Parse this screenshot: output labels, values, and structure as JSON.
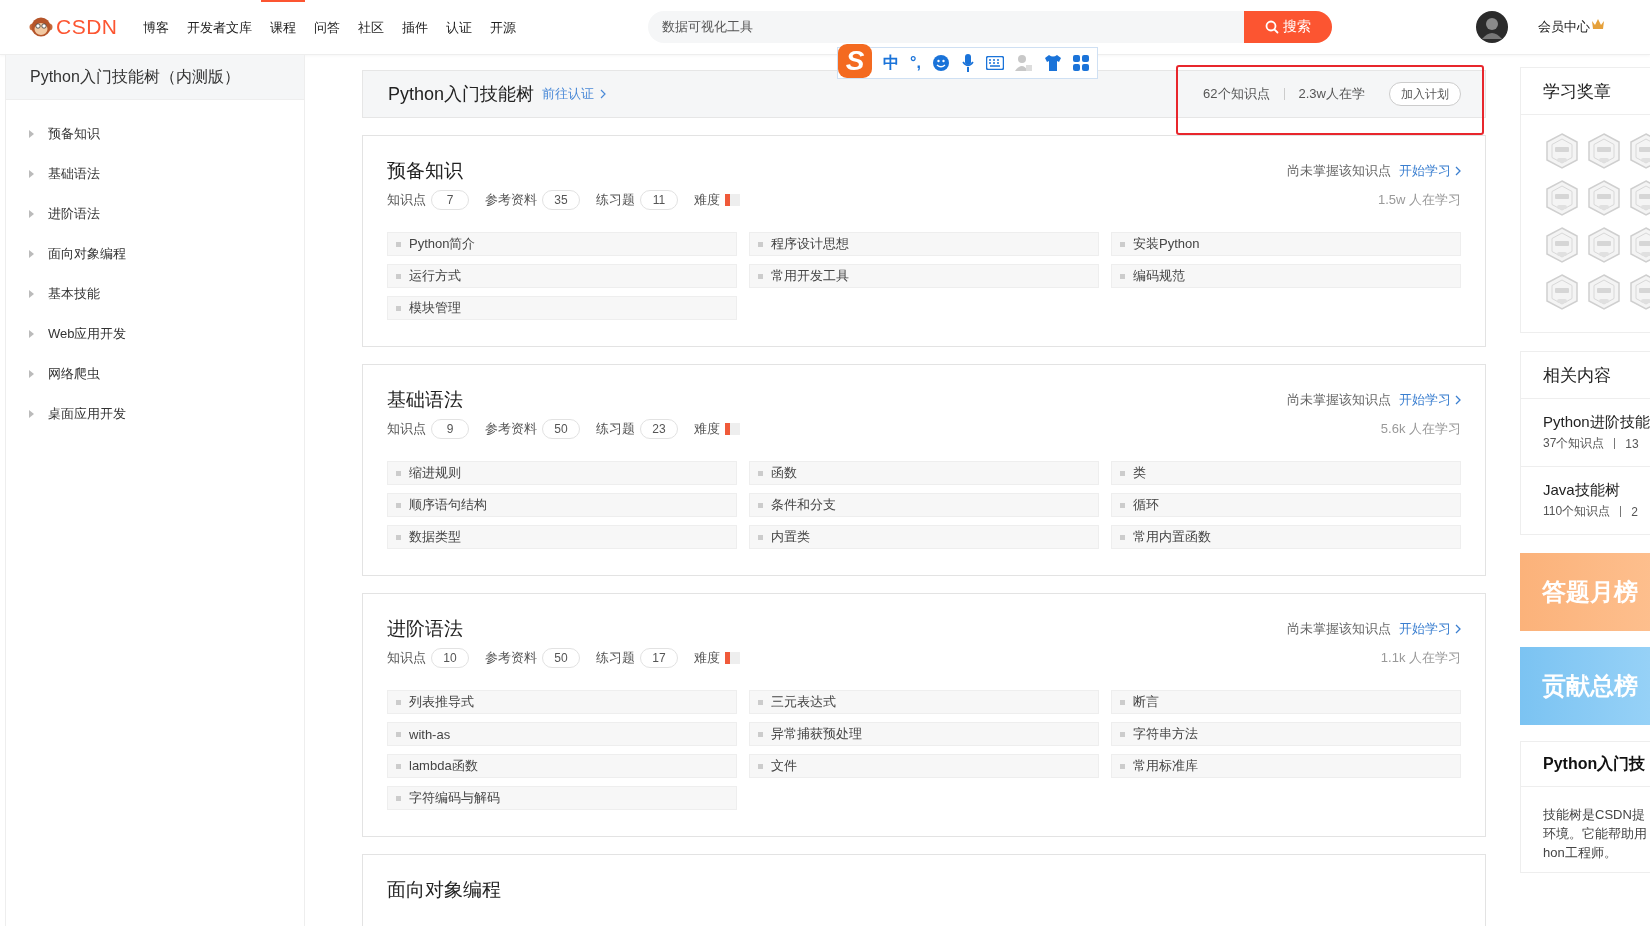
{
  "topbar": {
    "logo": "CSDN",
    "nav": [
      {
        "label": "博客",
        "selected": false
      },
      {
        "label": "开发者文库",
        "selected": false
      },
      {
        "label": "课程",
        "selected": true
      },
      {
        "label": "问答",
        "selected": false
      },
      {
        "label": "社区",
        "selected": false
      },
      {
        "label": "插件",
        "selected": false
      },
      {
        "label": "认证",
        "selected": false
      },
      {
        "label": "开源",
        "selected": false
      }
    ],
    "search": {
      "value": "数据可视化工具",
      "button": "搜索"
    },
    "member": "会员中心"
  },
  "ime_toolbar": {
    "logo": "S",
    "mode": "中",
    "punct": "°,"
  },
  "sidebar": {
    "title": "Python入门技能树（内测版）",
    "items": [
      {
        "label": "预备知识",
        "expanded": false
      },
      {
        "label": "基础语法",
        "expanded": false
      },
      {
        "label": "进阶语法",
        "expanded": false
      },
      {
        "label": "面向对象编程",
        "expanded": false
      },
      {
        "label": "基本技能",
        "expanded": false
      },
      {
        "label": "Web应用开发",
        "expanded": false
      },
      {
        "label": "网络爬虫",
        "expanded": false
      },
      {
        "label": "桌面应用开发",
        "expanded": false
      }
    ]
  },
  "course": {
    "title": "Python入门技能树",
    "link": "前往认证",
    "stats": [
      "62个知识点",
      "2.3w人在学"
    ],
    "button": "加入计划",
    "highlighted": true
  },
  "sections": [
    {
      "title": "预备知识",
      "hint": "尚未掌握该知识点",
      "action": "开始学习",
      "counts": [
        {
          "label": "知识点",
          "value": "7"
        },
        {
          "label": "参考资料",
          "value": "35"
        },
        {
          "label": "练习题",
          "value": "11"
        }
      ],
      "difficulty_label": "难度",
      "difficulty": {
        "level": 0.33
      },
      "learners": "1.5w 人在学习",
      "topics": [
        "Python简介",
        "程序设计思想",
        "安装Python",
        "运行方式",
        "常用开发工具",
        "编码规范",
        "模块管理"
      ]
    },
    {
      "title": "基础语法",
      "hint": "尚未掌握该知识点",
      "action": "开始学习",
      "counts": [
        {
          "label": "知识点",
          "value": "9"
        },
        {
          "label": "参考资料",
          "value": "50"
        },
        {
          "label": "练习题",
          "value": "23"
        }
      ],
      "difficulty_label": "难度",
      "difficulty": {
        "level": 0.33
      },
      "learners": "5.6k 人在学习",
      "topics": [
        "缩进规则",
        "函数",
        "类",
        "顺序语句结构",
        "条件和分支",
        "循环",
        "数据类型",
        "内置类",
        "常用内置函数"
      ]
    },
    {
      "title": "进阶语法",
      "hint": "尚未掌握该知识点",
      "action": "开始学习",
      "counts": [
        {
          "label": "知识点",
          "value": "10"
        },
        {
          "label": "参考资料",
          "value": "50"
        },
        {
          "label": "练习题",
          "value": "17"
        }
      ],
      "difficulty_label": "难度",
      "difficulty": {
        "level": 0.33
      },
      "learners": "1.1k 人在学习",
      "topics": [
        "列表推导式",
        "三元表达式",
        "断言",
        "with-as",
        "异常捕获预处理",
        "字符串方法",
        "lambda函数",
        "文件",
        "常用标准库",
        "字符编码与解码"
      ]
    },
    {
      "title": "面向对象编程"
    }
  ],
  "badges_panel": {
    "title": "学习奖章"
  },
  "related": {
    "title": "相关内容",
    "items": [
      {
        "title": "Python进阶技能",
        "knowledge": "37个知识点",
        "extra": "13"
      },
      {
        "title": "Java技能树",
        "knowledge": "110个知识点",
        "extra": "2"
      }
    ]
  },
  "banners": [
    {
      "kind": "orange",
      "label": "答题月榜"
    },
    {
      "kind": "blue",
      "label": "贡献总榜"
    }
  ],
  "intro": {
    "title": "Python入门技",
    "lines": [
      "技能树是CSDN提",
      "环境。它能帮助用",
      "hon工程师。"
    ]
  }
}
